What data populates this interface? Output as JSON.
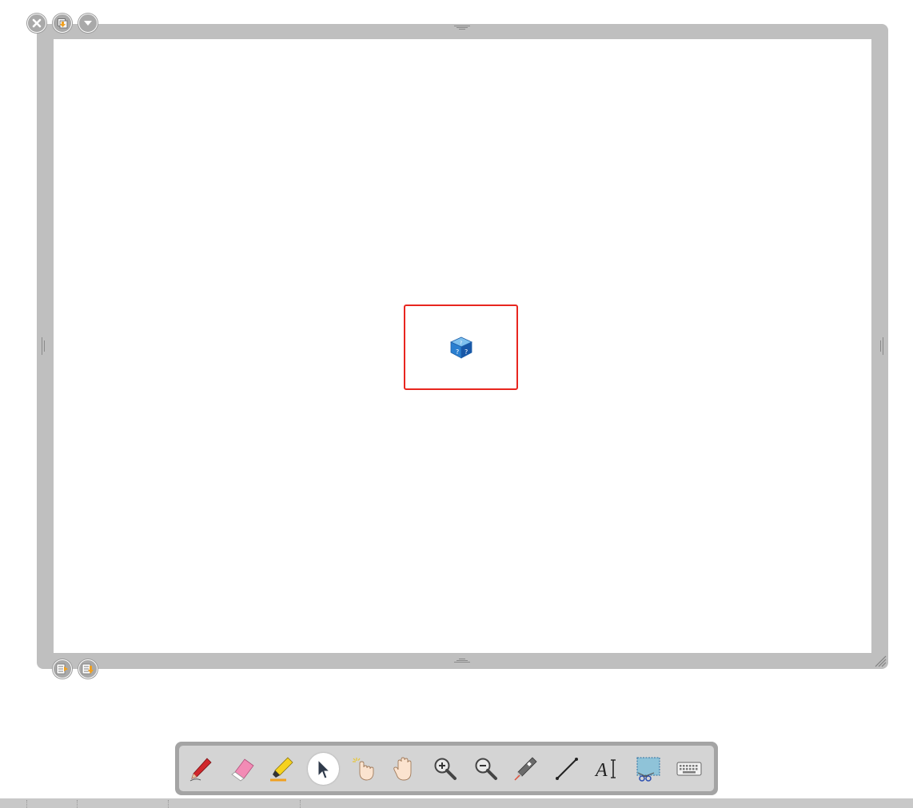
{
  "window_controls": {
    "close_icon": "close-icon",
    "restore_icon": "restore-window-icon",
    "menu_icon": "chevron-down-icon"
  },
  "page_controls": {
    "previous_icon": "page-list-icon",
    "next_icon": "page-list-down-icon"
  },
  "canvas": {
    "selected_object_icon": "question-cube-icon",
    "selection_color": "#e8261f"
  },
  "toolbar": {
    "tools": [
      {
        "name": "pen",
        "icon": "pen-icon",
        "active": false
      },
      {
        "name": "eraser",
        "icon": "eraser-icon",
        "active": false
      },
      {
        "name": "highlighter",
        "icon": "highlighter-icon",
        "active": false
      },
      {
        "name": "select",
        "icon": "cursor-arrow-icon",
        "active": true
      },
      {
        "name": "interact",
        "icon": "tap-hand-icon",
        "active": false
      },
      {
        "name": "pan",
        "icon": "hand-icon",
        "active": false
      },
      {
        "name": "zoom-in",
        "icon": "zoom-in-icon",
        "active": false
      },
      {
        "name": "zoom-out",
        "icon": "zoom-out-icon",
        "active": false
      },
      {
        "name": "magic-pen",
        "icon": "magic-pen-icon",
        "active": false
      },
      {
        "name": "line",
        "icon": "line-icon",
        "active": false
      },
      {
        "name": "text",
        "icon": "text-icon",
        "active": false
      },
      {
        "name": "screen-capture",
        "icon": "screen-capture-icon",
        "active": false
      },
      {
        "name": "keyboard",
        "icon": "keyboard-icon",
        "active": false
      }
    ]
  },
  "colors": {
    "frame": "#bfbfbf",
    "toolbar_outer": "#a4a4a4",
    "toolbar_inner": "#d4d4d4",
    "accent_orange": "#f0a020"
  }
}
